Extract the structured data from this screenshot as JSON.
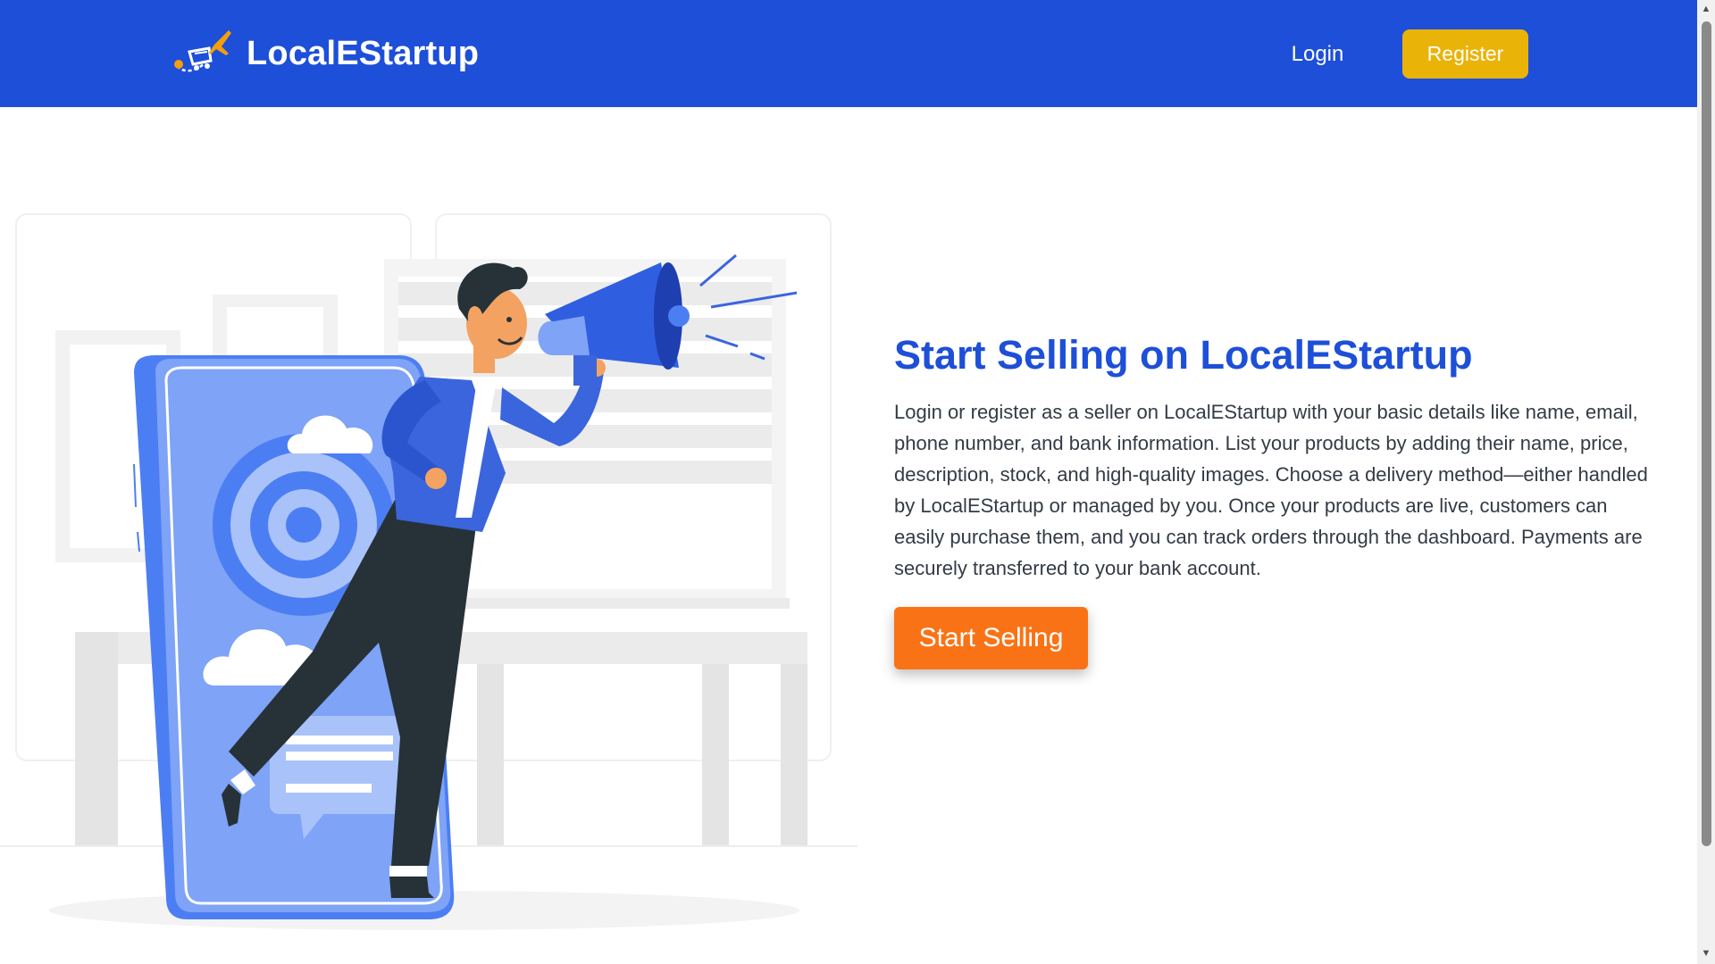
{
  "navbar": {
    "brand_name": "LocalEStartup",
    "logo_icon": "delivery-cart-airplane-icon",
    "login_label": "Login",
    "register_label": "Register",
    "colors": {
      "background": "#1d4fd8",
      "register_button": "#eab308"
    }
  },
  "hero": {
    "title": "Start Selling on LocalEStartup",
    "description": "Login or register as a seller on LocalEStartup with your basic details like name, email, phone number, and bank information. List your products by adding their name, price, description, stock, and high-quality images. Choose a delivery method—either handled by LocalEStartup or managed by you. Once your products are live, customers can easily purchase them, and you can track orders through the dashboard. Payments are securely transferred to your bank account.",
    "cta_label": "Start Selling",
    "illustration": "man-with-megaphone-phone-target-illustration",
    "colors": {
      "title": "#1d4fd8",
      "cta": "#f97316"
    }
  },
  "scrollbar": {
    "up_icon": "scroll-up-arrow-icon",
    "down_icon": "scroll-down-arrow-icon"
  }
}
